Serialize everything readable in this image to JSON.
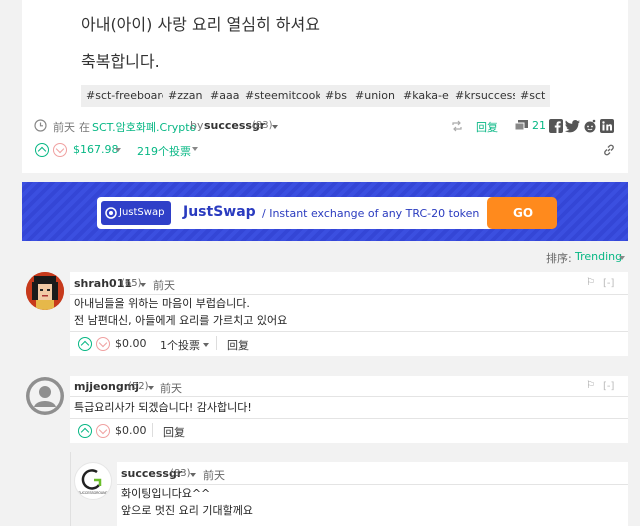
{
  "post": {
    "line1": "아내(아이) 사랑 요리 열심히 하셔요",
    "line2": "축복합니다.",
    "tags": [
      "#sct-freeboard",
      "#zzan",
      "#aaa",
      "#steemitcook",
      "#bs",
      "#union",
      "#kaka-e",
      "#krsuccess",
      "#sct"
    ],
    "time": "前天",
    "in_word": "在",
    "community": "SCT.암호화폐.Crypto",
    "by_word": "by",
    "author": "successgr",
    "author_rep": "(83)",
    "reply_label": "回复",
    "comment_count": "21",
    "payout": "$167.98",
    "votes": "219个投票"
  },
  "banner": {
    "logo_text": "JustSwap",
    "title": "JustSwap",
    "tagline": "/ Instant exchange of any TRC-20 token",
    "go_label": "GO",
    "colors": {
      "background": "#3b4fe0",
      "go": "#ff8a1d"
    }
  },
  "sort": {
    "label": "排序:",
    "value": "Trending"
  },
  "comments": [
    {
      "author": "shrah011",
      "rep": "(65)",
      "time": "前天",
      "lines": [
        "아내님들을 위하는 마음이 부럽습니다.",
        "전 남편대신, 아들에게 요리를 가르치고 있어요"
      ],
      "payout": "$0.00",
      "votes": "1个投票",
      "reply_label": "回复",
      "collapse": "[-]"
    },
    {
      "author": "mjjeongmj",
      "rep": "(52)",
      "time": "前天",
      "lines": [
        "특급요리사가 되겠습니다! 감사합니다!"
      ],
      "payout": "$0.00",
      "reply_label": "回复",
      "collapse": "[-]"
    },
    {
      "author": "successgr",
      "rep": "(83)",
      "time": "前天",
      "lines": [
        "화이팅입니다요^^",
        "앞으로 멋진 요리 기대할께요"
      ],
      "avatar_text": "SUCCESSGROUND"
    }
  ],
  "colors": {
    "accent": "#07b784",
    "banner": "#3b4fe0"
  }
}
